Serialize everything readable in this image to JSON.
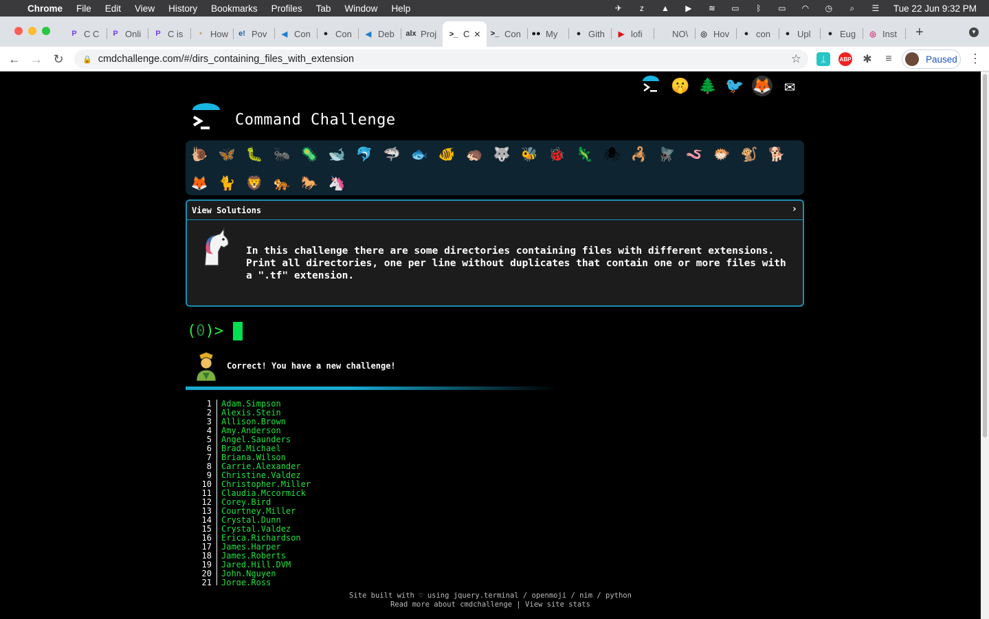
{
  "menubar": {
    "app": "Chrome",
    "items": [
      "File",
      "Edit",
      "View",
      "History",
      "Bookmarks",
      "Profiles",
      "Tab",
      "Window",
      "Help"
    ],
    "clock": "Tue 22 Jun  9:32 PM"
  },
  "tabs": [
    {
      "label": "C C",
      "icon": "P",
      "color": "#7a3bf0"
    },
    {
      "label": "Onli",
      "icon": "P",
      "color": "#7a3bf0"
    },
    {
      "label": "C is",
      "icon": "P",
      "color": "#7a3bf0"
    },
    {
      "label": "How",
      "icon": "•",
      "color": "#c8a060"
    },
    {
      "label": "Pov",
      "icon": "e!",
      "color": "#1b5fa8"
    },
    {
      "label": "Con",
      "icon": "◀",
      "color": "#1f7fd0"
    },
    {
      "label": "Con",
      "icon": "●",
      "color": "#222"
    },
    {
      "label": "Deb",
      "icon": "◀",
      "color": "#1f7fd0"
    },
    {
      "label": "Proj",
      "icon": "alx",
      "color": "#333"
    },
    {
      "label": "C",
      "icon": ">_",
      "color": "#111"
    },
    {
      "label": "Con",
      "icon": ">_",
      "color": "#111"
    },
    {
      "label": "My",
      "icon": "●●",
      "color": "#111"
    },
    {
      "label": "Gith",
      "icon": "●",
      "color": "#222"
    },
    {
      "label": "lofi",
      "icon": "▶",
      "color": "#e01010"
    },
    {
      "label": "NO\\",
      "icon": "",
      "color": "#dee1e6"
    },
    {
      "label": "Hov",
      "icon": "◎",
      "color": "#444"
    },
    {
      "label": "con",
      "icon": "●",
      "color": "#222"
    },
    {
      "label": "Upl",
      "icon": "●",
      "color": "#222"
    },
    {
      "label": "Eug",
      "icon": "●",
      "color": "#222"
    },
    {
      "label": "Inst",
      "icon": "◎",
      "color": "#d6337a"
    }
  ],
  "address": {
    "url": "cmdchallenge.com/#/dirs_containing_files_with_extension"
  },
  "profile": {
    "label": "Paused"
  },
  "site": {
    "title": "Command Challenge",
    "solutions_label": "View Solutions",
    "description": "In this challenge there are some directories containing files with different extensions. Print all directories, one per line without duplicates that contain one or more files with a \".tf\" extension.",
    "prompt_open": "(",
    "prompt_count": "0",
    "prompt_close": ")>",
    "message": "Correct! You have a new challenge!",
    "footer_line1": "Site built with ♡ using jquery.terminal / openmoji / nim / python",
    "footer_line2": "Read more about cmdchallenge | View site stats"
  },
  "animals": [
    "snail-icon",
    "butterfly-icon",
    "caterpillar-icon",
    "ant-icon",
    "microbe-icon",
    "whale-icon",
    "dolphin-icon",
    "shark-icon",
    "fish-icon",
    "tropical-fish-icon",
    "hedgehog-icon",
    "wolf-icon",
    "bee-icon",
    "ladybug-icon",
    "lizard-icon",
    "spider-icon",
    "scorpion-icon",
    "fly-icon",
    "worm-icon",
    "blowfish-icon",
    "monkey-icon",
    "dog-icon",
    "fox-icon",
    "cat-icon",
    "lion-icon",
    "tiger-icon",
    "horse-icon",
    "unicorn-icon"
  ],
  "output": [
    "Adam.Simpson",
    "Alexis.Stein",
    "Allison.Brown",
    "Amy.Anderson",
    "Angel.Saunders",
    "Brad.Michael",
    "Briana.Wilson",
    "Carrie.Alexander",
    "Christine.Valdez",
    "Christopher.Miller",
    "Claudia.Mccormick",
    "Corey.Bird",
    "Courtney.Miller",
    "Crystal.Dunn",
    "Crystal.Valdez",
    "Erica.Richardson",
    "James.Harper",
    "James.Roberts",
    "Jared.Hill.DVM",
    "John.Nguyen",
    "Jorge.Ross"
  ],
  "colors": {
    "accent": "#1a8fb3",
    "prompt": "#22ee44",
    "output": "#22e040",
    "panel_bg": "#1c1c1c",
    "animals_bg": "#0e2430"
  }
}
